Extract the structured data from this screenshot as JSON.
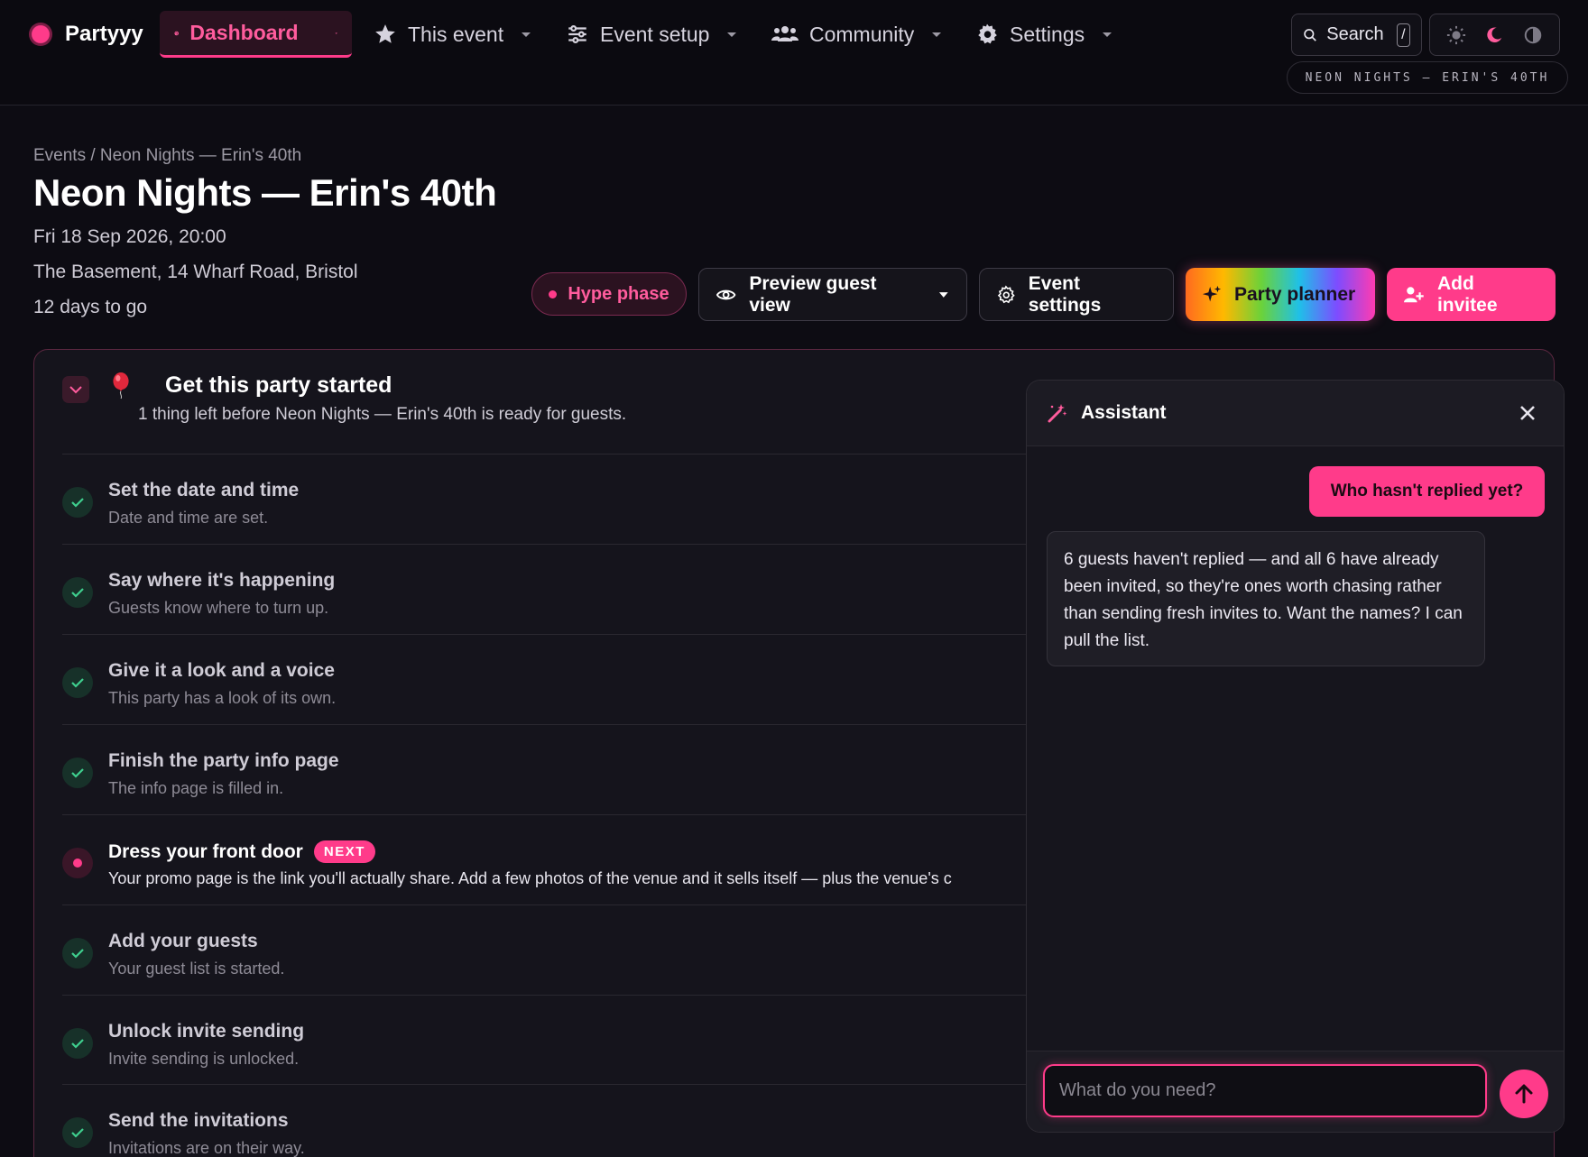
{
  "brand": {
    "name": "Partyyy"
  },
  "nav": {
    "items": [
      {
        "label": "Dashboard",
        "icon": "palette-icon",
        "active": true
      },
      {
        "label": "This event",
        "icon": "star-icon"
      },
      {
        "label": "Event setup",
        "icon": "sliders-icon"
      },
      {
        "label": "Community",
        "icon": "users-icon"
      },
      {
        "label": "Settings",
        "icon": "gear-icon"
      }
    ],
    "search_label": "Search",
    "search_shortcut": "/",
    "event_chip": "NEON NIGHTS — ERIN'S 40TH"
  },
  "header": {
    "breadcrumb": "Events / Neon Nights — Erin's 40th",
    "title": "Neon Nights — Erin's 40th",
    "datetime": "Fri 18 Sep 2026, 20:00",
    "venue": "The Basement, 14 Wharf Road, Bristol",
    "countdown": "12 days to go",
    "phase": "Hype phase",
    "actions": {
      "preview": "Preview guest view",
      "event_settings": "Event settings",
      "party_planner": "Party planner",
      "add_invitee": "Add invitee"
    }
  },
  "checklist": {
    "title": "Get this party started",
    "subtitle": "1 thing left before Neon Nights — Erin's 40th is ready for guests.",
    "tasks": [
      {
        "title": "Set the date and time",
        "desc": "Date and time are set.",
        "done": true
      },
      {
        "title": "Say where it's happening",
        "desc": "Guests know where to turn up.",
        "done": true
      },
      {
        "title": "Give it a look and a voice",
        "desc": "This party has a look of its own.",
        "done": true
      },
      {
        "title": "Finish the party info page",
        "desc": "The info page is filled in.",
        "done": true
      },
      {
        "title": "Dress your front door",
        "desc": "Your promo page is the link you'll actually share. Add a few photos of the venue and it sells itself — plus the venue's c",
        "done": false,
        "badge": "NEXT"
      },
      {
        "title": "Add your guests",
        "desc": "Your guest list is started.",
        "done": true
      },
      {
        "title": "Unlock invite sending",
        "desc": "Invite sending is unlocked.",
        "done": true
      },
      {
        "title": "Send the invitations",
        "desc": "Invitations are on their way.",
        "done": true
      }
    ]
  },
  "assistant": {
    "title": "Assistant",
    "user_message": "Who hasn't replied yet?",
    "bot_message": "6 guests haven't replied — and all 6 have already been invited, so they're ones worth chasing rather than sending fresh invites to. Want the names? I can pull the list.",
    "input_placeholder": "What do you need?"
  },
  "colors": {
    "accent": "#ff3b8a",
    "background": "#0d0c13",
    "success": "#3fcf8e"
  }
}
